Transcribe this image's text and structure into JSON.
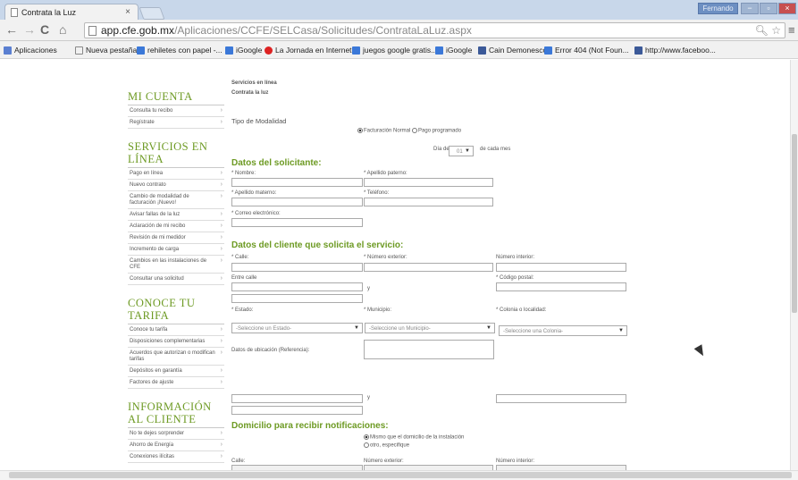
{
  "browser": {
    "tab_title": "Contrata la Luz",
    "tab_close": "×",
    "user_label": "Fernando",
    "url_host": "app.cfe.gob.mx",
    "url_path": "/Aplicaciones/CCFE/SELCasa/Solicitudes/ContrataLaLuz.aspx",
    "window_controls": [
      "−",
      "▫",
      "×"
    ]
  },
  "bookmarks": [
    {
      "label": "Aplicaciones",
      "color": "#5a7fd1"
    },
    {
      "label": "Nueva pestaña",
      "color": "#ffffff"
    },
    {
      "label": "rehiletes con papel -...",
      "color": "#3b78d8"
    },
    {
      "label": "iGoogle",
      "color": "#3b78d8"
    },
    {
      "label": "La Jornada en Internet",
      "color": "#d22"
    },
    {
      "label": "juegos google gratis...",
      "color": "#3b78d8"
    },
    {
      "label": "iGoogle",
      "color": "#3b78d8"
    },
    {
      "label": "Cain Demonesco",
      "color": "#3b5998"
    },
    {
      "label": "Error 404 (Not Foun...",
      "color": "#3b78d8"
    },
    {
      "label": "http://www.faceboo...",
      "color": "#3b5998"
    }
  ],
  "sidebar": {
    "mi_cuenta": {
      "title": "MI CUENTA",
      "items": [
        "Consulta tu recibo",
        "Regístrate"
      ]
    },
    "servicios": {
      "title": "SERVICIOS EN LÍNEA",
      "items": [
        "Pago en línea",
        "Nuevo contrato",
        "Cambio de modalidad de facturación ¡Nuevo!",
        "Avisar fallas de la luz",
        "Aclaración de mi recibo",
        "Revisión de mi medidor",
        "Incremento de carga",
        "Cambios en las instalaciones de CFE",
        "Consultar una solicitud"
      ]
    },
    "conoce": {
      "title": "CONOCE TU TARIFA",
      "items": [
        "Conoce tu tarifa",
        "Disposiciones complementarias",
        "Acuerdos que autorizan o modifican tarifas",
        "Depósitos en garantía",
        "Factores de ajuste"
      ]
    },
    "info": {
      "title": "INFORMACIÓN AL CLIENTE",
      "items": [
        "No te dejes sorprender",
        "Ahorro de Energía",
        "Conexiones ilícitas"
      ]
    }
  },
  "main": {
    "servicios": "Servicios en línea",
    "contrata": "Contrata la luz",
    "tipo_modalidad": "Tipo de Modalidad",
    "facturacion_normal": "Facturación Normal",
    "pago_programado": "Pago programado",
    "dia_pago_label": "Día de pago",
    "dia_pago_value": "01",
    "cada_mes": "de cada mes",
    "solicitante_heading": "Datos del solicitante:",
    "nombre": "* Nombre:",
    "apellido_paterno": "* Apellido paterno:",
    "apellido_materno": "* Apellido materno:",
    "telefono": "* Teléfono:",
    "correo": "* Correo electrónico:",
    "cliente_heading": "Datos del cliente que solicita el servicio:",
    "calle": "* Calle:",
    "numero_exterior": "* Número exterior:",
    "numero_interior": "Número interior:",
    "entre_calle": "Entre calle",
    "y": "y",
    "codigo_postal": "* Código postal:",
    "estado": "* Estado:",
    "municipio": "* Municipio:",
    "colonia": "* Colonia o localidad:",
    "estado_ph": "-Seleccione un Estado-",
    "municipio_ph": "-Seleccione un Municipio-",
    "colonia_ph": "-Seleccione una Colonia-",
    "ubicacion": "Datos de ubicación (Referencia):",
    "domicilio_heading": "Domicilio para recibir notificaciones:",
    "mismo": "Mismo que el domicilio de la instalación",
    "otro": "otro, especifique",
    "calle2": "Calle:",
    "numero_exterior2": "Número exterior:",
    "numero_interior2": "Número interior:"
  },
  "colors": {
    "accent": "#6d9a23"
  }
}
